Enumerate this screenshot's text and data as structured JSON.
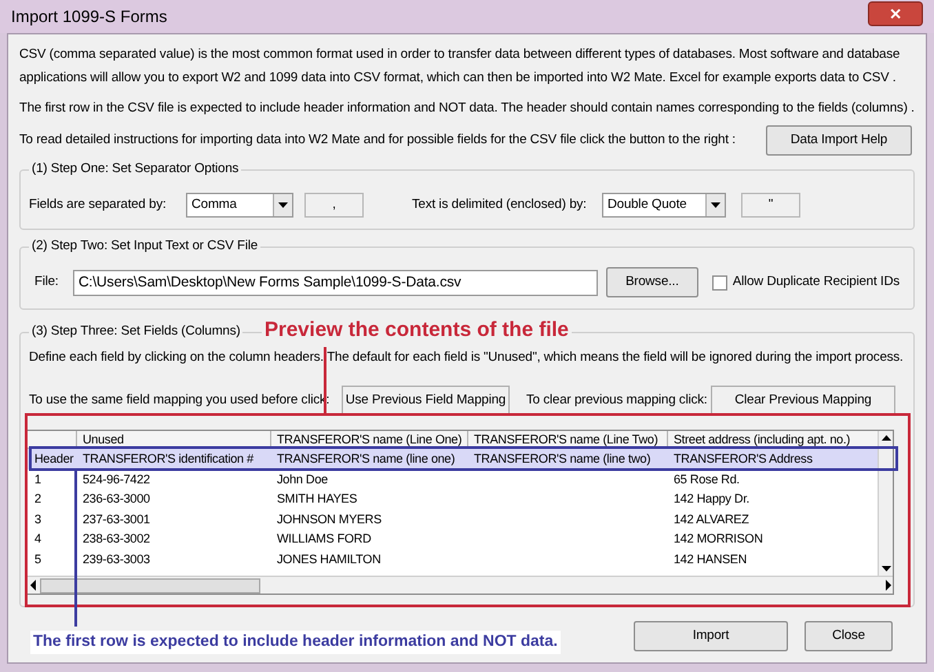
{
  "window": {
    "title": "Import 1099-S Forms",
    "close_label": "✕"
  },
  "intro": [
    "CSV (comma separated value) is the most common format used in order to transfer data between different types of databases.  Most software and database applications will allow you to export W2 and 1099 data into CSV format, which can then be imported into W2 Mate. Excel for example exports data to CSV .",
    "The first row in the CSV file is expected to include header information and NOT data. The header should contain names corresponding to the fields (columns) ."
  ],
  "help": {
    "text": "To read detailed instructions for importing data into W2 Mate and for possible fields for the CSV file click the button to the right :",
    "button": "Data Import Help"
  },
  "step_one": {
    "legend": "(1)  Step One: Set Separator Options",
    "fields_label": "Fields are separated by:",
    "fields_value": "Comma",
    "fields_char": ",",
    "text_label": "Text is delimited (enclosed) by:",
    "text_value": "Double Quote",
    "text_char": "\""
  },
  "step_two": {
    "legend": "(2)  Step Two: Set Input Text or CSV File",
    "file_label": "File:",
    "file_value": "C:\\Users\\Sam\\Desktop\\New Forms Sample\\1099-S-Data.csv",
    "browse": "Browse...",
    "allow_duplicates": {
      "label": "Allow Duplicate Recipient IDs",
      "checked": false
    }
  },
  "step_three": {
    "legend": "(3)  Step Three: Set Fields (Columns)",
    "description": "Define each field by clicking on the column headers. The default for each field is \"Unused\", which means the field will be ignored during the import process.",
    "previous_label": "To use the same field mapping you used before click:",
    "previous_button": "Use Previous Field Mapping",
    "clear_label": "To clear previous mapping click:",
    "clear_button": "Clear Previous Mapping"
  },
  "table": {
    "columns": [
      "",
      "Unused",
      "TRANSFEROR'S name (Line One)",
      "TRANSFEROR'S name (Line Two)",
      "Street address (including apt. no.)"
    ],
    "rows": [
      [
        "Header",
        "TRANSFEROR'S identification #",
        "TRANSFEROR'S name (line one)",
        "TRANSFEROR'S name (line two)",
        "TRANSFEROR'S Address"
      ],
      [
        "1",
        "524-96-7422",
        "John Doe",
        "",
        "65 Rose Rd."
      ],
      [
        "2",
        "236-63-3000",
        "SMITH HAYES",
        "",
        "142 Happy Dr."
      ],
      [
        "3",
        "237-63-3001",
        "JOHNSON MYERS",
        "",
        "142 ALVAREZ"
      ],
      [
        "4",
        "238-63-3002",
        "WILLIAMS FORD",
        "",
        "142 MORRISON"
      ],
      [
        "5",
        "239-63-3003",
        "JONES HAMILTON",
        "",
        "142 HANSEN"
      ]
    ]
  },
  "annotations": {
    "preview": "Preview the contents of the file",
    "first_row": "The first row is expected to include header information and NOT data."
  },
  "buttons": [
    "Import",
    "Close"
  ]
}
